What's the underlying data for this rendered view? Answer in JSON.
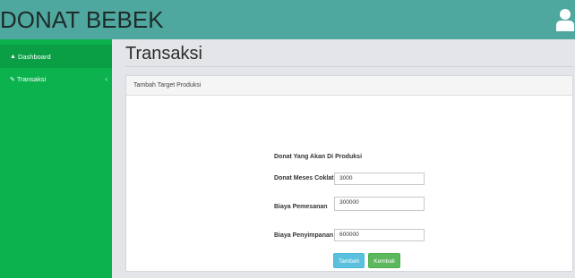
{
  "app": {
    "brand": "DONAT BEBEK"
  },
  "icons": {
    "user": "user-icon",
    "dashboard": "home-icon",
    "transaksi": "edit-icon",
    "chevron": "chevron-left-icon"
  },
  "colors": {
    "topbar": "#4fa89f",
    "sidebar": "#0bb24e",
    "button_primary": "#5bc0de",
    "button_success": "#5cb85c"
  },
  "sidebar": {
    "items": [
      {
        "label": "Dashboard"
      },
      {
        "label": "Transaksi"
      }
    ]
  },
  "main": {
    "title": "Transaksi",
    "panel_heading": "Tambah Target Produksi",
    "form": {
      "heading": "Donat Yang Akan Di Produksi",
      "fields": [
        {
          "label": "Donat Meses Coklat",
          "value": "3000"
        },
        {
          "label": "Biaya Pemesanan",
          "value": "300000"
        },
        {
          "label": "Biaya Penyimpanan",
          "value": "600000"
        }
      ],
      "submit_label": "Tambah",
      "back_label": "Kembali"
    }
  }
}
